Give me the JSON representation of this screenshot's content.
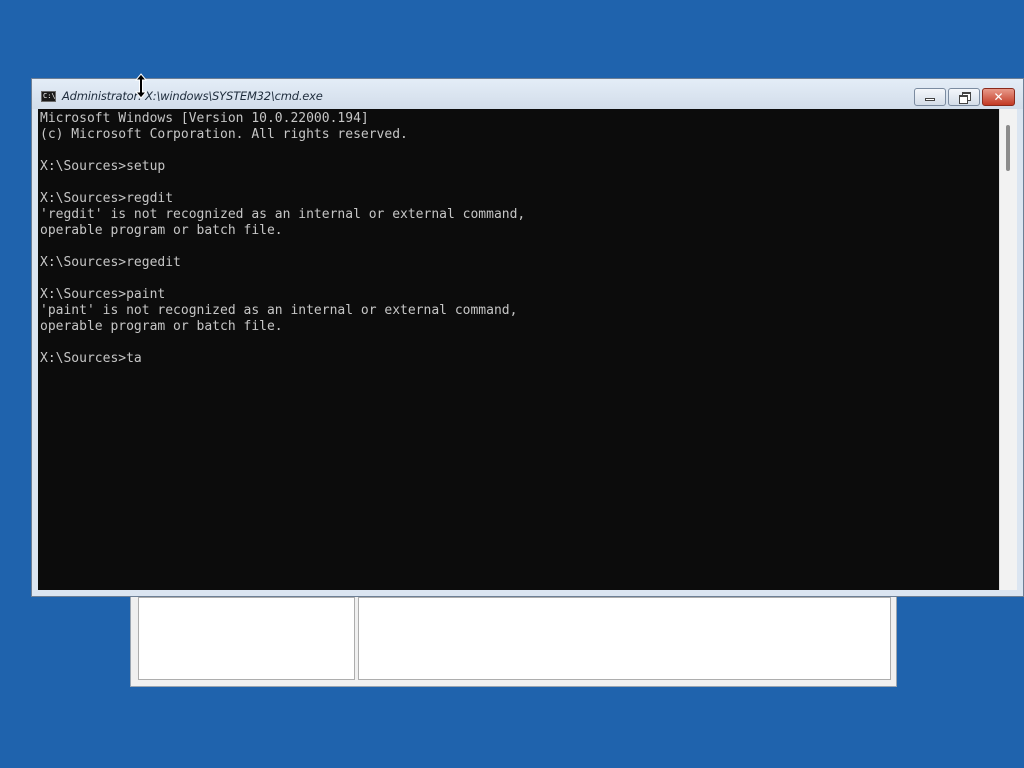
{
  "window": {
    "title": "Administrator: X:\\windows\\SYSTEM32\\cmd.exe",
    "icon_text": "C:\\",
    "controls": {
      "minimize": "minimize-icon",
      "maximize": "restore-icon",
      "close": "✕"
    }
  },
  "console": {
    "lines": [
      "Microsoft Windows [Version 10.0.22000.194]",
      "(c) Microsoft Corporation. All rights reserved.",
      "",
      "X:\\Sources>setup",
      "",
      "X:\\Sources>regdit",
      "'regdit' is not recognized as an internal or external command,",
      "operable program or batch file.",
      "",
      "X:\\Sources>regedit",
      "",
      "X:\\Sources>paint",
      "'paint' is not recognized as an internal or external command,",
      "operable program or batch file.",
      "",
      "X:\\Sources>ta"
    ]
  },
  "colors": {
    "desktop": "#1f63ad",
    "console_background": "#0c0c0c",
    "console_text": "#c6c6c6",
    "close_button": "#c23a25"
  },
  "cursor": {
    "icon": "resize-vertical-cursor-icon"
  }
}
